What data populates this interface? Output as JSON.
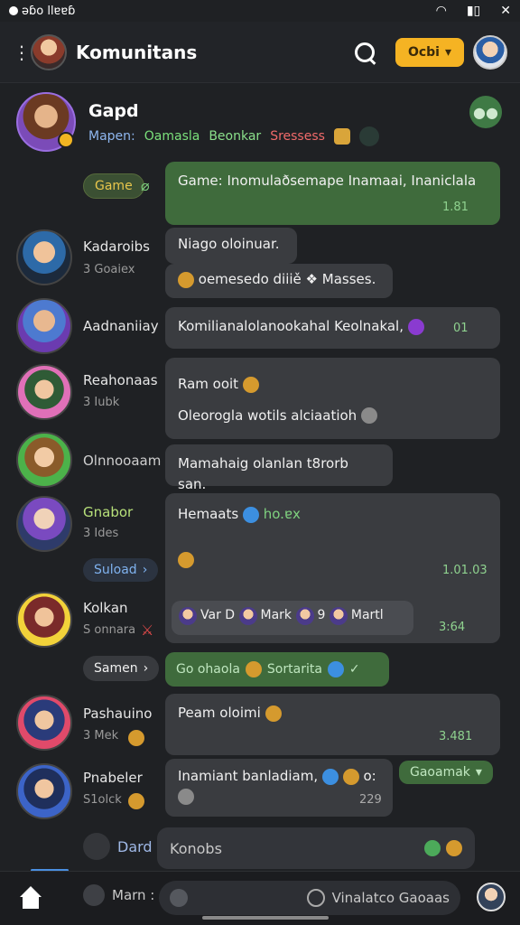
{
  "status": {
    "left_text": "ǝɓo llɐɐɓ",
    "right_icons": [
      "wifi-icon",
      "signal-icon",
      "close-icon"
    ]
  },
  "header": {
    "title": "Komunitans",
    "button_label": "Ocbi",
    "button_color": "#f5b323"
  },
  "group": {
    "name": "Gapd",
    "meta": [
      "Mapen:",
      "Oamasla",
      "Beonkar",
      "Sressess"
    ]
  },
  "messages": [
    {
      "pill": "Game",
      "text": "Game: Inomulaðsemape Inamaai, Inaniclala",
      "time": "1.81"
    },
    {
      "name": "Kadaroibs",
      "sub": "3 Goaiex",
      "text1": "Niago oloinuar.",
      "text2": "oemesedo diiiě ❖ Masses."
    },
    {
      "name": "Aadnaniiay",
      "text": "Komilianalolanookahal Keolnakal,",
      "time": "01"
    },
    {
      "name": "Reahonaas",
      "sub": "3 Iubk",
      "text1": "Ram ooit",
      "text2": "Oleorogla wotils alciaatioh"
    },
    {
      "name": "Olnnooaam",
      "text": "Mamahaig olanlan t8rorb san."
    },
    {
      "name": "Gnabor",
      "sub": "3 Ides",
      "pill": "Suload",
      "text": "Hemaats",
      "text_tail": "ho.ɐx",
      "time": "1.01.03"
    },
    {
      "name": "Kolkan",
      "sub": "S onnara",
      "chips": [
        "Var D",
        "Mark",
        "9",
        "Martl"
      ],
      "time": "3:64"
    },
    {
      "pill": "Samen",
      "green_pill": "Go ohaola",
      "green_pill_2": "Sortarita"
    },
    {
      "name": "Pashauino",
      "sub": "3 Mek",
      "text": "Peam oloimi",
      "time": "3.481"
    },
    {
      "name": "Pnabeler",
      "sub": "S1olck",
      "text": "Inamiant banladiam,",
      "text_tail": "o:",
      "count": "229",
      "green_pill": "Gaoamak"
    }
  ],
  "composer": {
    "side_label": "Dard",
    "placeholder": "Konobs"
  },
  "bottom": {
    "left_label": "Marn :",
    "search_label": "Vinalatco Gaoaas"
  }
}
